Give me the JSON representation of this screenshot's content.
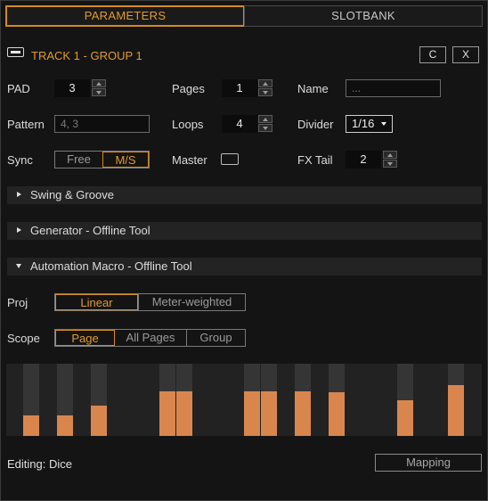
{
  "tabs": {
    "parameters": "PARAMETERS",
    "slotbank": "SLOTBANK"
  },
  "header": {
    "track_title": "TRACK 1 - GROUP 1",
    "clear_label": "C",
    "close_label": "X"
  },
  "fields": {
    "pad": {
      "label": "PAD",
      "value": "3"
    },
    "pages": {
      "label": "Pages",
      "value": "1"
    },
    "name": {
      "label": "Name",
      "placeholder": "..."
    },
    "pattern": {
      "label": "Pattern",
      "placeholder": "4, 3"
    },
    "loops": {
      "label": "Loops",
      "value": "4"
    },
    "divider": {
      "label": "Divider",
      "value": "1/16"
    },
    "sync": {
      "label": "Sync",
      "options": [
        "Free",
        "M/S"
      ],
      "selected": "M/S"
    },
    "master": {
      "label": "Master",
      "checked": false
    },
    "fx_tail": {
      "label": "FX Tail",
      "value": "2"
    }
  },
  "sections": {
    "swing": {
      "label": "Swing & Groove",
      "expanded": false
    },
    "generator": {
      "label": "Generator - Offline Tool",
      "expanded": false
    },
    "automation": {
      "label": "Automation Macro - Offline Tool",
      "expanded": true
    }
  },
  "automation": {
    "proj": {
      "label": "Proj",
      "options": [
        "Linear",
        "Meter-weighted"
      ],
      "selected": "Linear"
    },
    "scope": {
      "label": "Scope",
      "options": [
        "Page",
        "All Pages",
        "Group"
      ],
      "selected": "Page"
    }
  },
  "chart_data": {
    "type": "bar",
    "steps": 28,
    "active_steps": [
      1,
      3,
      5,
      9,
      10,
      14,
      15,
      17,
      19,
      23,
      26
    ],
    "values": [
      0,
      0.28,
      0,
      0.28,
      0,
      0.42,
      0,
      0,
      0,
      0.62,
      0.62,
      0,
      0,
      0,
      0.62,
      0.62,
      0,
      0.62,
      0,
      0.6,
      0,
      0,
      0,
      0.49,
      0,
      0,
      0.7,
      0
    ],
    "colors": {
      "active_bg": "#353535",
      "bar": "#d9864e",
      "track": "#222222"
    }
  },
  "footer": {
    "editing_text": "Editing: Dice",
    "mapping_label": "Mapping"
  },
  "colors": {
    "accent": "#d48a1f",
    "background": "#141414"
  }
}
